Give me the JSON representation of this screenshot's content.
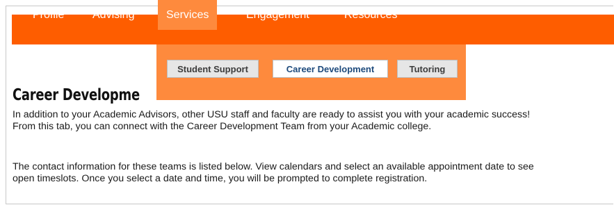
{
  "nav": {
    "items": [
      {
        "label": "Profile"
      },
      {
        "label": "Advising"
      },
      {
        "label": "Services"
      },
      {
        "label": "Engagement"
      },
      {
        "label": "Resources"
      }
    ],
    "active": "Services"
  },
  "dropdown": {
    "items": [
      {
        "label": "Student Support"
      },
      {
        "label": "Career Development"
      },
      {
        "label": "Tutoring"
      }
    ],
    "selected": "Career Development"
  },
  "page": {
    "title": "Career Developme",
    "paragraph1": "In addition to your Academic Advisors, other USU staff and faculty are ready to assist you with your academic success! From this tab, you can connect with the Career Development Team from your Academic college.",
    "paragraph2": "The contact information for these teams is listed below. View calendars and select an available appointment date to see open timeslots. Once you select a date and time, you will be prompted to complete registration."
  },
  "colors": {
    "nav_bg": "#fe5d00",
    "dropdown_bg": "#fe8a3d",
    "selected_text": "#1d4a7c"
  }
}
